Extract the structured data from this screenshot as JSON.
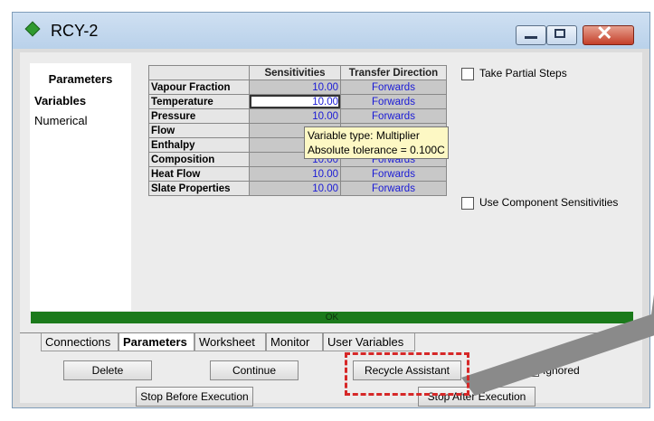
{
  "window": {
    "title": "RCY-2"
  },
  "sidebar": {
    "header": "Parameters",
    "items": [
      {
        "label": "Variables"
      },
      {
        "label": "Numerical"
      }
    ]
  },
  "grid": {
    "headers": [
      "Sensitivities",
      "Transfer Direction"
    ],
    "rows": [
      {
        "label": "Vapour Fraction",
        "sensitivity": "10.00",
        "direction": "Forwards"
      },
      {
        "label": "Temperature",
        "sensitivity": "10.00",
        "direction": "Forwards"
      },
      {
        "label": "Pressure",
        "sensitivity": "10.00",
        "direction": "Forwards"
      },
      {
        "label": "Flow",
        "sensitivity": "",
        "direction": ""
      },
      {
        "label": "Enthalpy",
        "sensitivity": "",
        "direction": ""
      },
      {
        "label": "Composition",
        "sensitivity": "10.00",
        "direction": "Forwards"
      },
      {
        "label": "Heat Flow",
        "sensitivity": "10.00",
        "direction": "Forwards"
      },
      {
        "label": "Slate Properties",
        "sensitivity": "10.00",
        "direction": "Forwards"
      }
    ]
  },
  "tooltip": {
    "line1": "Variable type: Multiplier",
    "line2": "Absolute tolerance = 0.100C"
  },
  "options": {
    "take_partial_steps": "Take Partial Steps",
    "use_component_sensitivities": "Use Component Sensitivities"
  },
  "status": {
    "text": "OK",
    "color": "#1b7a1b"
  },
  "tabs": [
    {
      "label": "Connections"
    },
    {
      "label": "Parameters"
    },
    {
      "label": "Worksheet"
    },
    {
      "label": "Monitor"
    },
    {
      "label": "User Variables"
    }
  ],
  "buttons": {
    "delete": "Delete",
    "continue": "Continue",
    "recycle_assistant": "Recycle Assistant",
    "stop_before": "Stop Before Execution",
    "stop_after": "Stop After Execution",
    "ignored": "Ignored"
  },
  "colors": {
    "accent_highlight": "#d62828",
    "value_text": "#1a1ad6"
  }
}
